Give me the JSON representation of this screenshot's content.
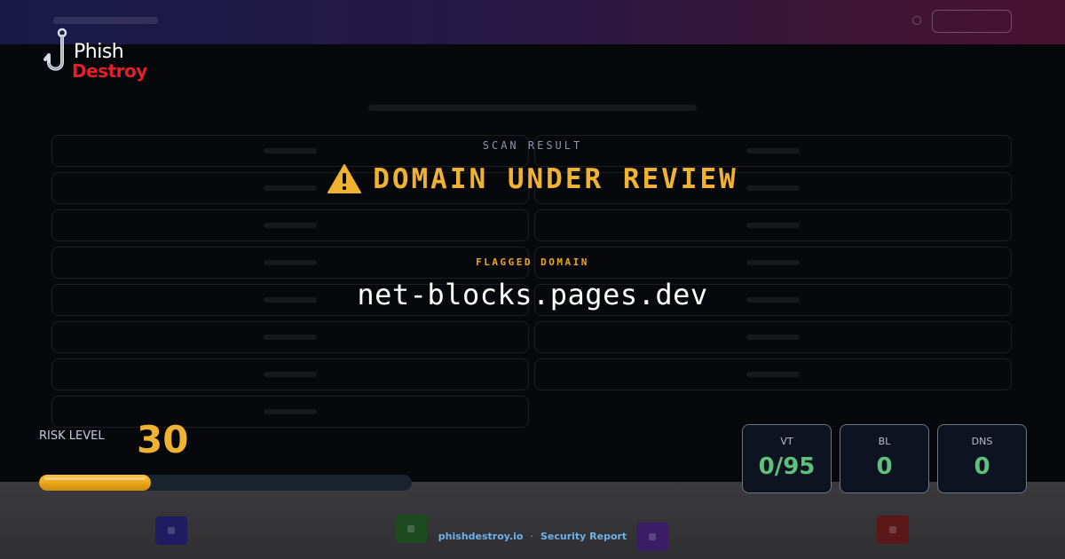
{
  "brand": {
    "name_line1": "Phish",
    "name_line2": "Destroy",
    "logo_icon": "fishhook-icon",
    "colors": {
      "white": "#ffffff",
      "red": "#e0202a"
    }
  },
  "scan": {
    "label": "SCAN RESULT",
    "status": "DOMAIN UNDER REVIEW",
    "status_icon": "warning-triangle-icon",
    "flagged_label": "FLAGGED DOMAIN",
    "domain": "net-blocks.pages.dev"
  },
  "risk": {
    "label": "RISK LEVEL",
    "value": "30",
    "fraction": 0.3
  },
  "stats": [
    {
      "label": "VT",
      "value": "0/95"
    },
    {
      "label": "BL",
      "value": "0"
    },
    {
      "label": "DNS",
      "value": "0"
    }
  ],
  "footer": {
    "site": "phishdestroy.io",
    "separator": "·",
    "report": "Security Report"
  },
  "colors": {
    "accent": "#f0b232",
    "flagged": "#e9a623",
    "stat_value": "#5fc07a",
    "footer_link": "#6fb0e8",
    "background": "#07080c"
  }
}
